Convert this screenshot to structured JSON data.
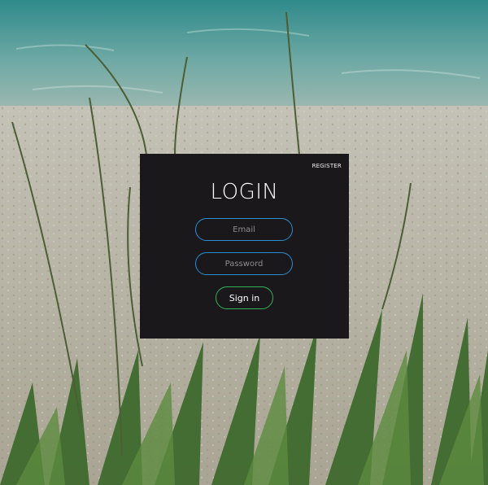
{
  "login_card": {
    "register_label": "REGISTER",
    "title": "LOGIN",
    "email_placeholder": "Email",
    "password_placeholder": "Password",
    "signin_label": "Sign in"
  },
  "colors": {
    "card_background": "#1a181b",
    "input_border": "#2a8fd1",
    "button_border": "#2fb45a"
  }
}
